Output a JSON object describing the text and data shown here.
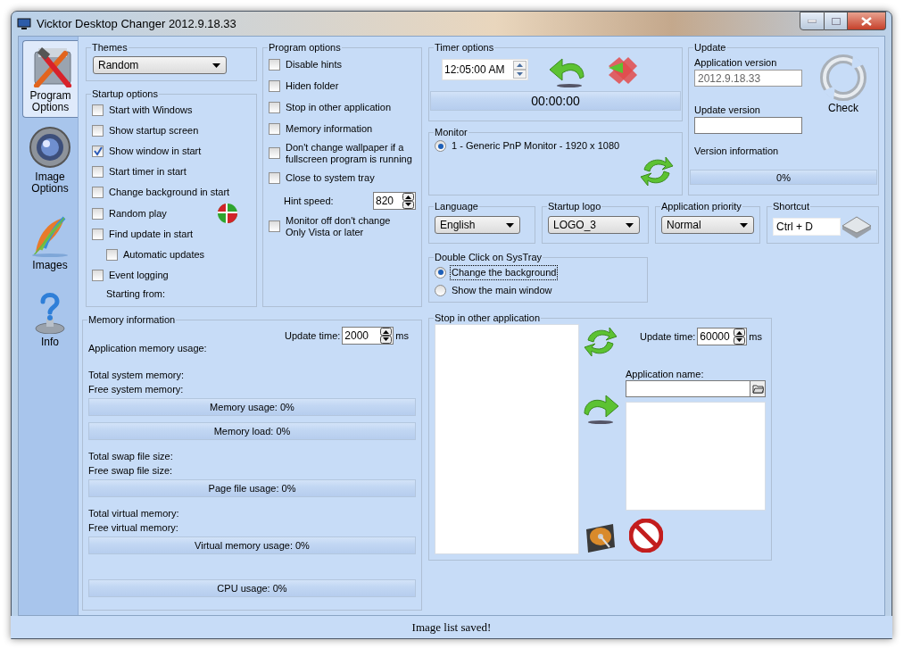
{
  "window": {
    "title": "Vicktor Desktop Changer 2012.9.18.33"
  },
  "sidebar": [
    {
      "label": "Program Options",
      "kind": "tools",
      "selected": true
    },
    {
      "label": "Image Options",
      "kind": "lens",
      "selected": false
    },
    {
      "label": "Images",
      "kind": "feather",
      "selected": false
    },
    {
      "label": "Info",
      "kind": "help",
      "selected": false
    }
  ],
  "themes": {
    "title": "Themes",
    "value": "Random"
  },
  "startup_options": {
    "title": "Startup options",
    "items": [
      {
        "label": "Start with Windows",
        "checked": false
      },
      {
        "label": "Show startup screen",
        "checked": false
      },
      {
        "label": "Show window in start",
        "checked": true
      },
      {
        "label": "Start timer in start",
        "checked": false
      },
      {
        "label": "Change background in start",
        "checked": false
      },
      {
        "label": "Random play",
        "checked": false
      },
      {
        "label": "Find update in start",
        "checked": false,
        "children": [
          {
            "label": "Automatic updates",
            "checked": false
          }
        ]
      },
      {
        "label": "Event logging",
        "checked": false
      }
    ],
    "note": "Starting from:"
  },
  "program_options": {
    "title": "Program options",
    "items": [
      {
        "label": "Disable hints",
        "checked": false
      },
      {
        "label": "Hiden folder",
        "checked": false
      },
      {
        "label": "Stop in other application",
        "checked": false
      },
      {
        "label": "Memory information",
        "checked": false
      },
      {
        "label": "Don't change wallpaper if a\nfullscreen program is running",
        "checked": false
      },
      {
        "label": "Close to system tray",
        "checked": false
      }
    ],
    "hint_speed": {
      "label": "Hint speed:",
      "value": "820"
    },
    "more_items": [
      {
        "label": "Monitor off don't change\nOnly Vista or later",
        "checked": false
      }
    ]
  },
  "timer_options": {
    "title": "Timer options",
    "time": "12:05:00 AM",
    "countdown": "00:00:00"
  },
  "monitor": {
    "title": "Monitor",
    "options": [
      {
        "label": "1 - Generic PnP Monitor - 1920 x 1080",
        "selected": true
      }
    ]
  },
  "update": {
    "title": "Update",
    "app_version_label": "Application version",
    "app_version": "2012.9.18.33",
    "update_version_label": "Update version",
    "check": "Check",
    "version_info": "Version information",
    "progress": {
      "label": "0%",
      "level": 0
    }
  },
  "language": {
    "title": "Language",
    "value": "English"
  },
  "startup_logo": {
    "title": "Startup logo",
    "value": "LOGO_3"
  },
  "application_priority": {
    "title": "Application priority",
    "value": "Normal"
  },
  "shortcut": {
    "title": "Shortcut",
    "value": "Ctrl + D"
  },
  "double_click": {
    "title": "Double Click on SysTray",
    "options": [
      {
        "label": "Change the background",
        "selected": true
      },
      {
        "label": "Show the main window",
        "selected": false
      }
    ]
  },
  "memory": {
    "title": "Memory information",
    "update_label": "Update time:",
    "update_value": "2000",
    "unit": "ms",
    "rows": [
      {
        "kind": "text",
        "label": "Application memory usage:"
      },
      {
        "kind": "text",
        "label": "Total system memory:"
      },
      {
        "kind": "text",
        "label": "Free system memory:"
      },
      {
        "kind": "meter",
        "label": "Memory usage: 0%",
        "level": 0
      },
      {
        "kind": "meter",
        "label": "Memory load: 0%",
        "level": 0
      },
      {
        "kind": "text",
        "label": "Total swap file size:"
      },
      {
        "kind": "text",
        "label": "Free swap file size:"
      },
      {
        "kind": "meter",
        "label": "Page file usage: 0%",
        "level": 0
      },
      {
        "kind": "text",
        "label": "Total virtual memory:"
      },
      {
        "kind": "text",
        "label": "Free virtual memory:"
      },
      {
        "kind": "meter",
        "label": "Virtual memory usage: 0%",
        "level": 0
      },
      {
        "kind": "meter",
        "label": "CPU usage: 0%",
        "level": 0
      }
    ]
  },
  "stop_application": {
    "title": "Stop in other application",
    "update_label": "Update time:",
    "update_value": "60000",
    "unit": "ms",
    "app_name_label": "Application name:"
  },
  "status_bar": "Image list saved!"
}
